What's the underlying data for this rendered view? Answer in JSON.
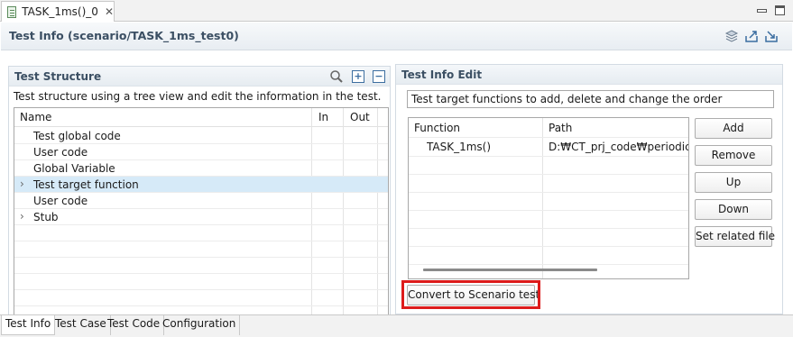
{
  "editor": {
    "tab_title": "TASK_1ms()_0",
    "tab_close": "✕",
    "file_icon": "c-source-file-icon"
  },
  "header": {
    "title": "Test Info (scenario/TASK_1ms_test0)",
    "icons": [
      "layers-icon",
      "export-icon",
      "import-icon"
    ]
  },
  "structure": {
    "title": "Test Structure",
    "description": "Test structure using a tree view and edit the information in the test.",
    "icons": [
      "search-icon",
      "expand-all-icon",
      "collapse-all-icon"
    ],
    "columns": [
      "Name",
      "In",
      "Out"
    ],
    "rows": [
      {
        "label": "Test global code",
        "expandable": false,
        "selected": false
      },
      {
        "label": "User code",
        "expandable": false,
        "selected": false
      },
      {
        "label": "Global Variable",
        "expandable": false,
        "selected": false
      },
      {
        "label": "Test target function",
        "expandable": true,
        "selected": true
      },
      {
        "label": "User code",
        "expandable": false,
        "selected": false
      },
      {
        "label": "Stub",
        "expandable": true,
        "selected": false
      }
    ],
    "expander_glyph": "›"
  },
  "info_edit": {
    "title": "Test Info Edit",
    "target_description": "Test target functions to add, delete and change the order",
    "columns": [
      "Function",
      "Path"
    ],
    "rows": [
      {
        "function": "TASK_1ms()",
        "path": "D:₩CT_prj_code₩periodic₩task.c"
      }
    ],
    "buttons": {
      "add": "Add",
      "remove": "Remove",
      "up": "Up",
      "down": "Down",
      "set_related": "Set related file"
    },
    "convert_button": "Convert to Scenario test"
  },
  "bottom_tabs": [
    "Test Info",
    "Test Case",
    "Test Code",
    "Configuration"
  ],
  "colors": {
    "accent_title": "#3b4f63",
    "selection": "#d6eaf8",
    "highlight_border": "#dd1b1b"
  }
}
